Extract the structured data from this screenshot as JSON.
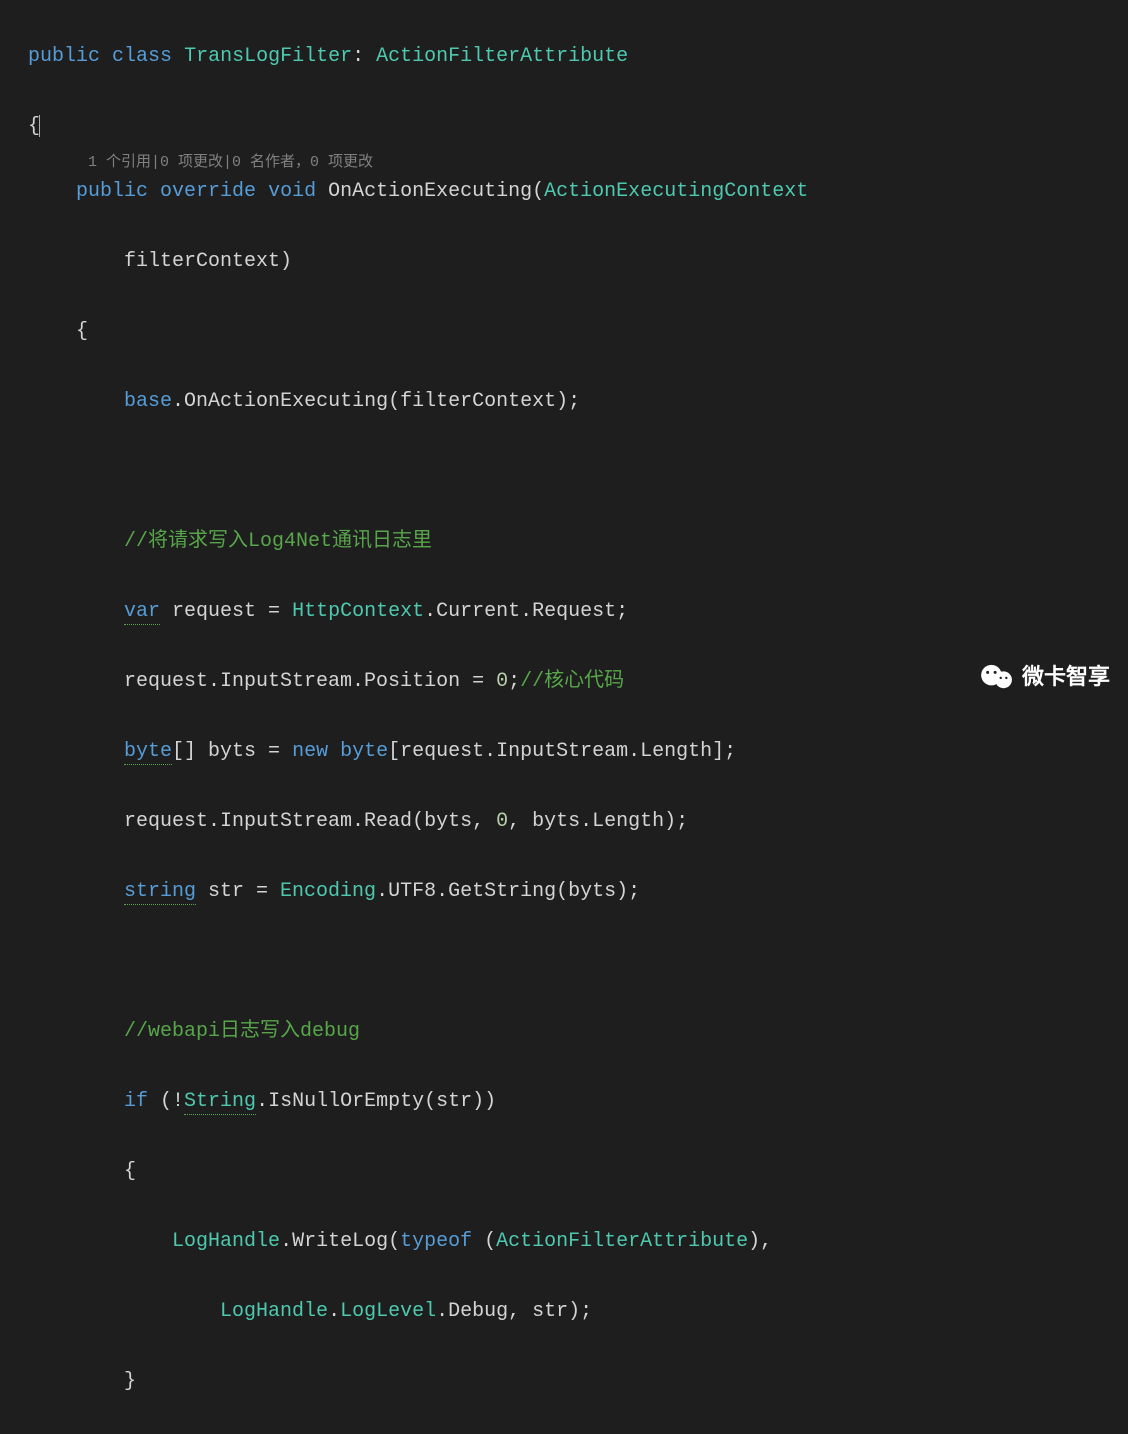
{
  "codelens": "1 个引用|0 项更改|0 名作者，0 项更改",
  "code": {
    "l1": {
      "public": "public",
      "class": "class",
      "name": "TransLogFilter",
      "colon": ": ",
      "base": "ActionFilterAttribute"
    },
    "l2": "{",
    "l4": {
      "public": "public",
      "override": "override",
      "void": "void",
      "method": "OnActionExecuting",
      "open": "(",
      "param_type": "ActionExecutingContext"
    },
    "l5": {
      "param_name": "filterContext",
      "close": ")"
    },
    "l6": "{",
    "l7": {
      "base": "base",
      "dot": ".",
      "call": "OnActionExecuting(filterContext);"
    },
    "l9": "//将请求写入Log4Net通讯日志里",
    "l10": {
      "var": "var",
      "sp": " request = ",
      "http": "HttpContext",
      "rest": ".Current.Request;"
    },
    "l11": {
      "a": "request.InputStream.Position = ",
      "zero": "0",
      "semi": ";",
      "comment": "//核心代码"
    },
    "l12": {
      "byte": "byte",
      "arr": "[] byts = ",
      "new": "new",
      "sp": " ",
      "byte2": "byte",
      "rest": "[request.InputStream.Length];"
    },
    "l13": {
      "a": "request.InputStream.Read(byts, ",
      "zero": "0",
      "rest": ", byts.Length);"
    },
    "l14": {
      "string": "string",
      "sp": " str = ",
      "enc": "Encoding",
      "rest": ".UTF8.GetString(byts);"
    },
    "l16": "//webapi日志写入debug",
    "l17": {
      "if": "if",
      "open": " (!",
      "str": "String",
      "rest": ".IsNullOrEmpty(str))"
    },
    "l18": "{",
    "l19": {
      "lh": "LogHandle",
      "mid": ".WriteLog(",
      "typeof": "typeof",
      "sp2": " (",
      "afa": "ActionFilterAttribute",
      "close": "),"
    },
    "l20": {
      "lh": "LogHandle",
      "dot": ".",
      "ll": "LogLevel",
      "rest": ".Debug, str);"
    },
    "l21": "}"
  },
  "watermark": "微卡智享"
}
